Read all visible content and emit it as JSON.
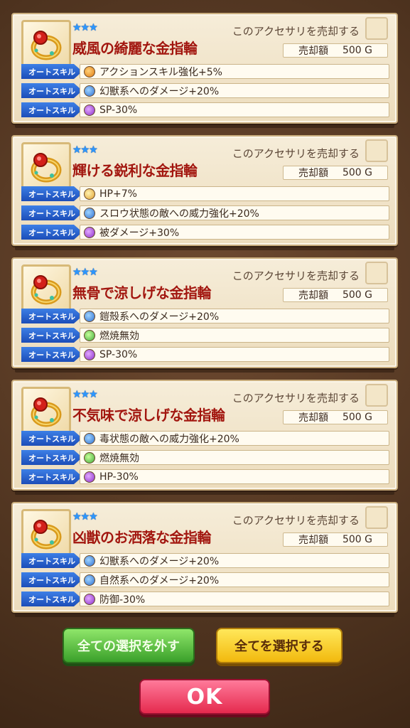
{
  "items": [
    {
      "stars": "★★★",
      "name": "威風の綺麗な金指輪",
      "sell_label": "このアクセサリを売却する",
      "price_label": "売却額",
      "price_value": "500 G",
      "skills": [
        {
          "tag": "オートスキル",
          "icon": "action-icon",
          "text": "アクションスキル強化+5%"
        },
        {
          "tag": "オートスキル",
          "icon": "beast-icon",
          "text": "幻獣系へのダメージ+20%"
        },
        {
          "tag": "オートスキル",
          "icon": "skull-icon",
          "text": "SP-30%"
        }
      ]
    },
    {
      "stars": "★★★",
      "name": "輝ける鋭利な金指輪",
      "sell_label": "このアクセサリを売却する",
      "price_label": "売却額",
      "price_value": "500 G",
      "skills": [
        {
          "tag": "オートスキル",
          "icon": "hp-icon",
          "text": "HP+7%"
        },
        {
          "tag": "オートスキル",
          "icon": "beast-icon",
          "text": "スロウ状態の敵への威力強化+20%"
        },
        {
          "tag": "オートスキル",
          "icon": "skull-icon",
          "text": "被ダメージ+30%"
        }
      ]
    },
    {
      "stars": "★★★",
      "name": "無骨で涼しげな金指輪",
      "sell_label": "このアクセサリを売却する",
      "price_label": "売却額",
      "price_value": "500 G",
      "skills": [
        {
          "tag": "オートスキル",
          "icon": "beast-icon",
          "text": "鎧殻系へのダメージ+20%"
        },
        {
          "tag": "オートスキル",
          "icon": "leaf-icon",
          "text": "燃焼無効"
        },
        {
          "tag": "オートスキル",
          "icon": "skull-icon",
          "text": "SP-30%"
        }
      ]
    },
    {
      "stars": "★★★",
      "name": "不気味で涼しげな金指輪",
      "sell_label": "このアクセサリを売却する",
      "price_label": "売却額",
      "price_value": "500 G",
      "skills": [
        {
          "tag": "オートスキル",
          "icon": "beast-icon",
          "text": "毒状態の敵への威力強化+20%"
        },
        {
          "tag": "オートスキル",
          "icon": "leaf-icon",
          "text": "燃焼無効"
        },
        {
          "tag": "オートスキル",
          "icon": "skull-icon",
          "text": "HP-30%"
        }
      ]
    },
    {
      "stars": "★★★",
      "name": "凶獣のお洒落な金指輪",
      "sell_label": "このアクセサリを売却する",
      "price_label": "売却額",
      "price_value": "500 G",
      "skills": [
        {
          "tag": "オートスキル",
          "icon": "beast-icon",
          "text": "幻獣系へのダメージ+20%"
        },
        {
          "tag": "オートスキル",
          "icon": "beast-icon",
          "text": "自然系へのダメージ+20%"
        },
        {
          "tag": "オートスキル",
          "icon": "skull-icon",
          "text": "防御-30%"
        }
      ]
    }
  ],
  "buttons": {
    "deselect_all": "全ての選択を外す",
    "select_all": "全てを選択する",
    "ok": "OK"
  },
  "colors": {
    "item_name": "#a2160f",
    "skill_tag": "#1c4db8",
    "stars": "#2c97ff"
  }
}
